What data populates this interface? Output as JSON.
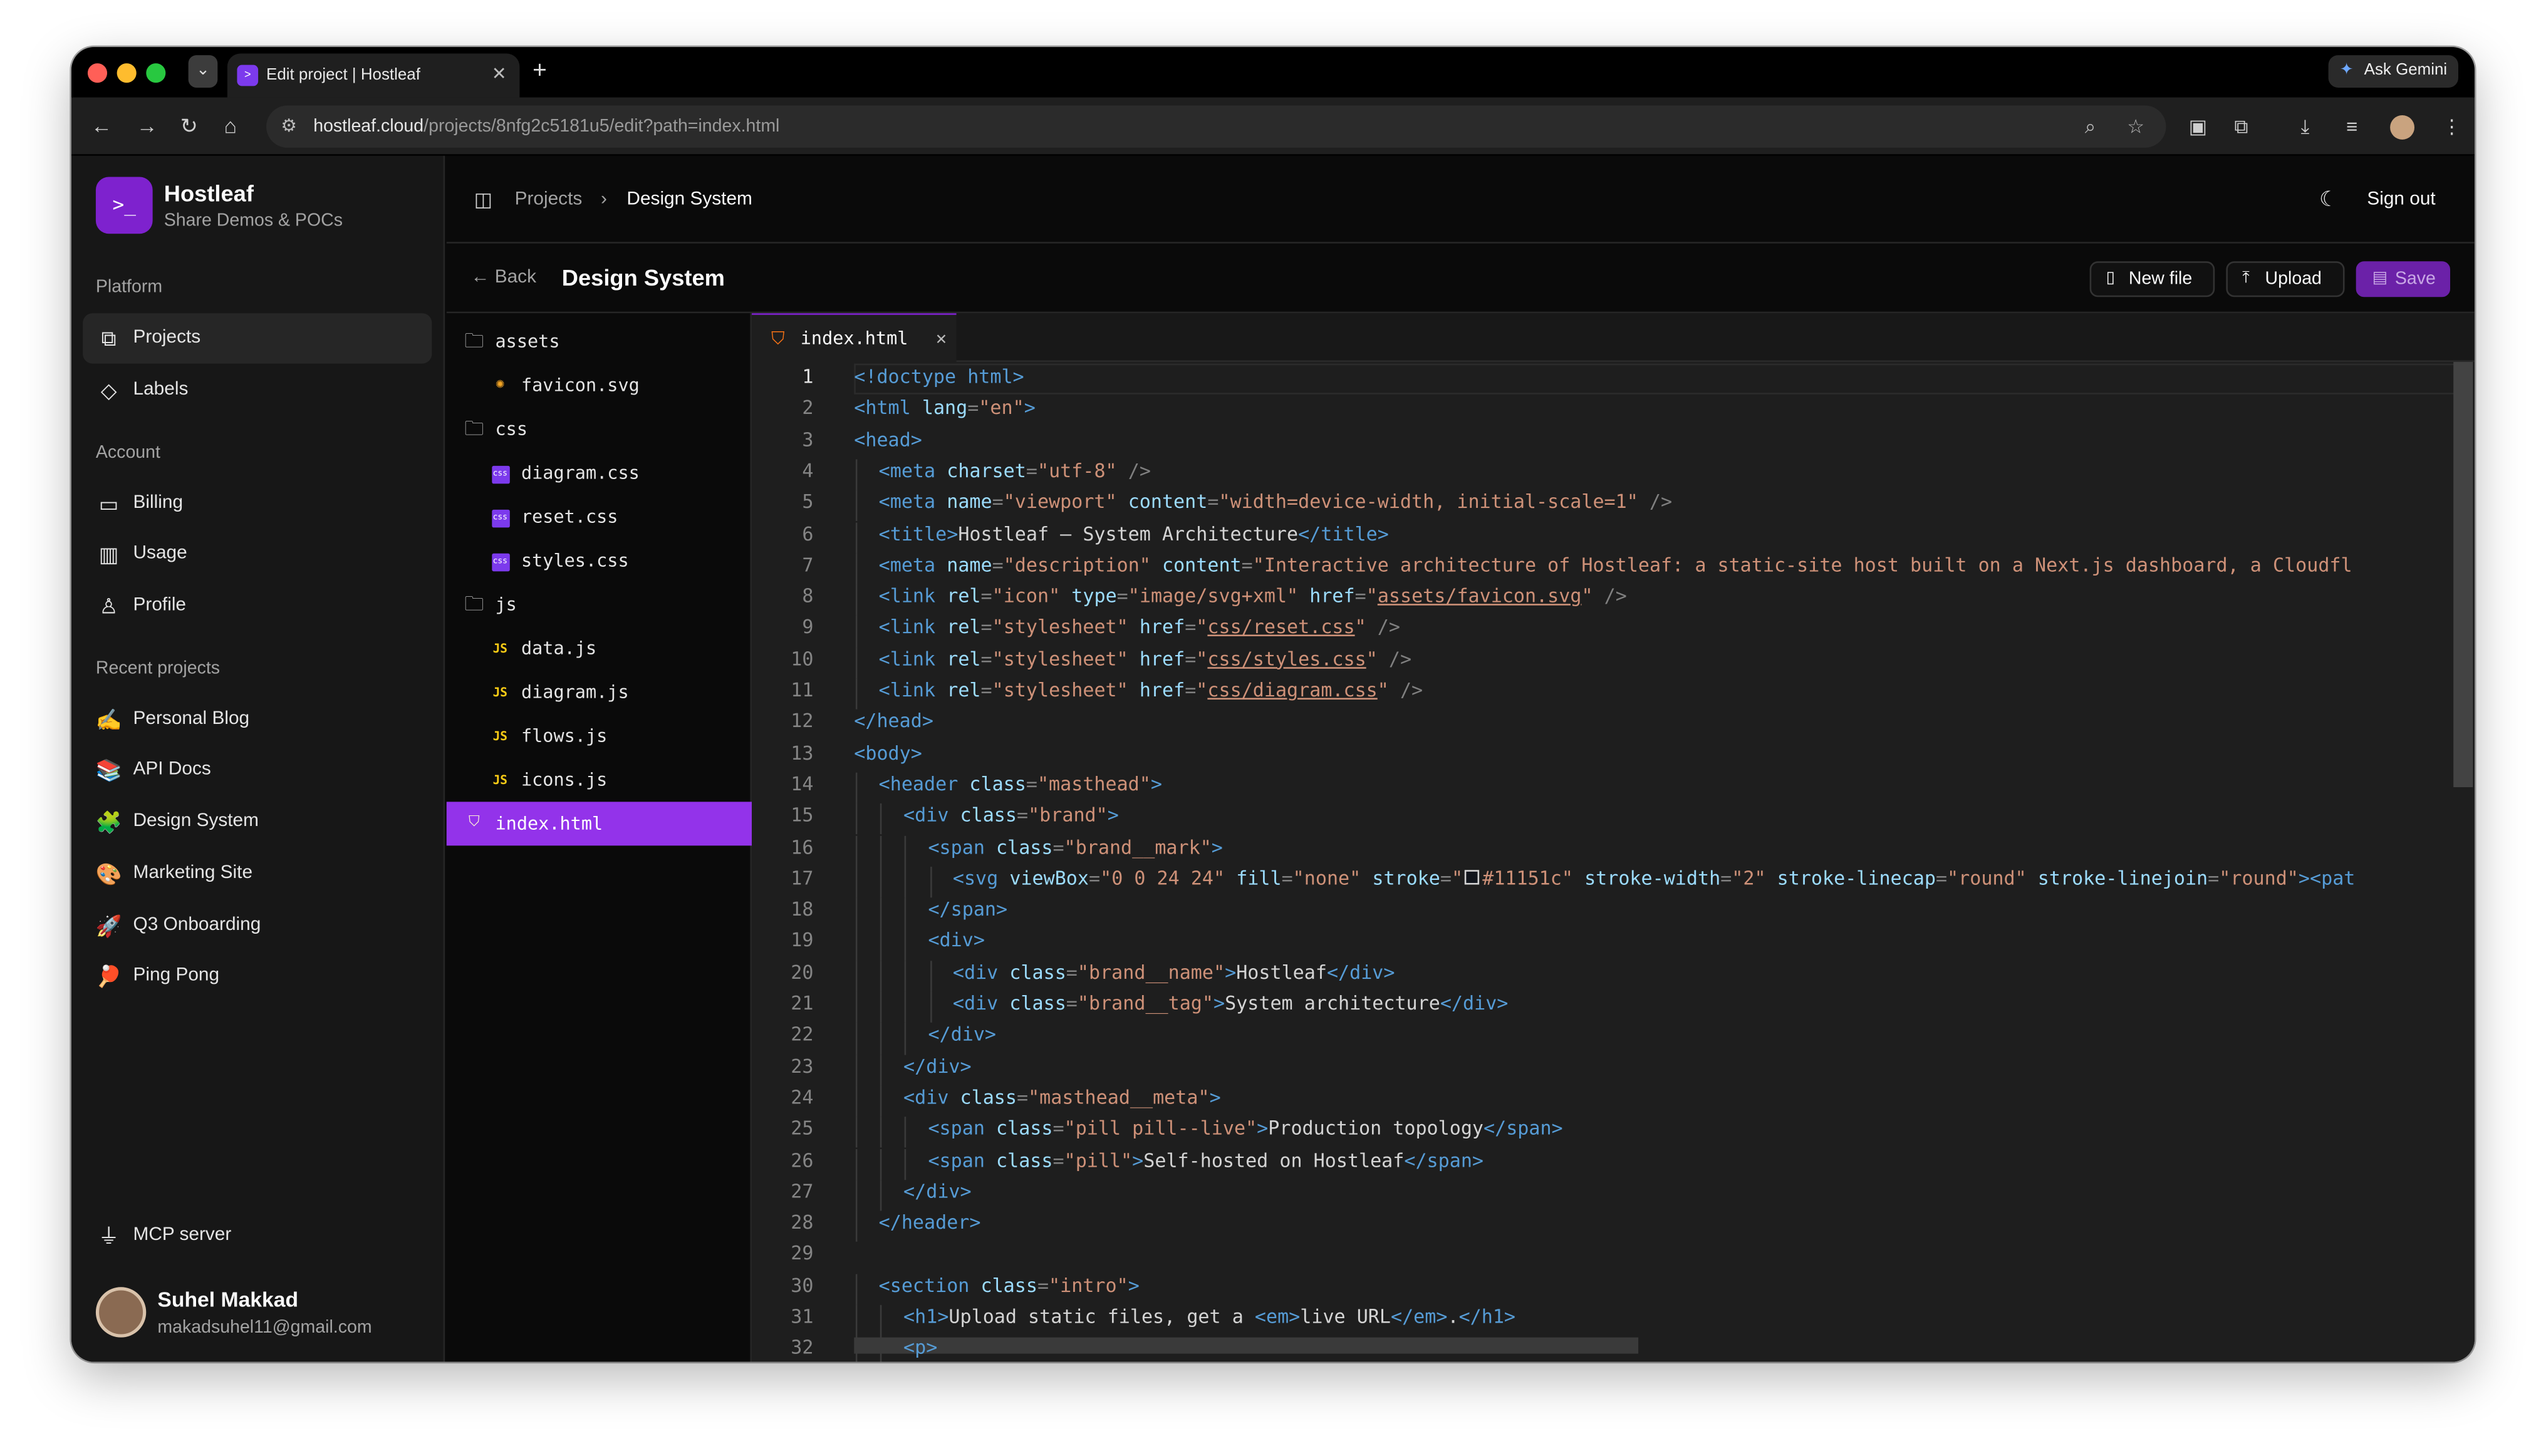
{
  "browser": {
    "tab_title": "Edit project | Hostleaf",
    "ask_gemini": "Ask Gemini",
    "url_host": "hostleaf.cloud",
    "url_path": "/projects/8nfg2c5181u5/edit?path=index.html",
    "traffic_colors": [
      "#ff5f57",
      "#febc2e",
      "#28c840"
    ]
  },
  "sidebar": {
    "brand_name": "Hostleaf",
    "brand_tag": "Share Demos & POCs",
    "logo_glyph": ">_",
    "sections": {
      "platform": "Platform",
      "account": "Account",
      "recent": "Recent projects"
    },
    "platform_items": [
      {
        "label": "Projects",
        "icon": "projects-icon",
        "active": true
      },
      {
        "label": "Labels",
        "icon": "tag-icon"
      }
    ],
    "account_items": [
      {
        "label": "Billing",
        "icon": "credit-card-icon"
      },
      {
        "label": "Usage",
        "icon": "bar-chart-icon"
      },
      {
        "label": "Profile",
        "icon": "user-icon"
      }
    ],
    "recent_projects": [
      {
        "label": "Personal Blog",
        "icon": "✍"
      },
      {
        "label": "API Docs",
        "icon": "📚"
      },
      {
        "label": "Design System",
        "icon": "🧩"
      },
      {
        "label": "Marketing Site",
        "icon": "🎨"
      },
      {
        "label": "Q3 Onboarding",
        "icon": "🚀"
      },
      {
        "label": "Ping Pong",
        "icon": "🏓"
      }
    ],
    "mcp_label": "MCP server",
    "user_name": "Suhel Makkad",
    "user_email": "makadsuhel11@gmail.com"
  },
  "header": {
    "breadcrumb_projects": "Projects",
    "breadcrumb_current": "Design System",
    "sign_out": "Sign out",
    "back": "Back",
    "project_title": "Design System",
    "new_file": "New file",
    "upload": "Upload",
    "save": "Save"
  },
  "files": [
    {
      "name": "assets",
      "type": "folder",
      "depth": 0
    },
    {
      "name": "favicon.svg",
      "type": "svg",
      "depth": 1
    },
    {
      "name": "css",
      "type": "folder",
      "depth": 0
    },
    {
      "name": "diagram.css",
      "type": "css",
      "depth": 1
    },
    {
      "name": "reset.css",
      "type": "css",
      "depth": 1
    },
    {
      "name": "styles.css",
      "type": "css",
      "depth": 1
    },
    {
      "name": "js",
      "type": "folder",
      "depth": 0
    },
    {
      "name": "data.js",
      "type": "js",
      "depth": 1
    },
    {
      "name": "diagram.js",
      "type": "js",
      "depth": 1
    },
    {
      "name": "flows.js",
      "type": "js",
      "depth": 1
    },
    {
      "name": "icons.js",
      "type": "js",
      "depth": 1
    },
    {
      "name": "index.html",
      "type": "html",
      "depth": 0,
      "selected": true
    }
  ],
  "editor": {
    "tab_label": "index.html",
    "current_line": 1,
    "lines": [
      {
        "indent": 0,
        "parts": [
          [
            "tg",
            "<!doctype html>"
          ]
        ]
      },
      {
        "indent": 0,
        "parts": [
          [
            "tg",
            "<html "
          ],
          [
            "at",
            "lang"
          ],
          [
            "pu",
            "="
          ],
          [
            "st",
            "\"en\""
          ],
          [
            "tg",
            ">"
          ]
        ]
      },
      {
        "indent": 0,
        "parts": [
          [
            "tg",
            "<head>"
          ]
        ]
      },
      {
        "indent": 1,
        "parts": [
          [
            "tg",
            "<meta "
          ],
          [
            "at",
            "charset"
          ],
          [
            "pu",
            "="
          ],
          [
            "st",
            "\"utf-8\""
          ],
          [
            "pu",
            " />"
          ]
        ]
      },
      {
        "indent": 1,
        "parts": [
          [
            "tg",
            "<meta "
          ],
          [
            "at",
            "name"
          ],
          [
            "pu",
            "="
          ],
          [
            "st",
            "\"viewport\" "
          ],
          [
            "at",
            "content"
          ],
          [
            "pu",
            "="
          ],
          [
            "st",
            "\"width=device-width, initial-scale=1\""
          ],
          [
            "pu",
            " />"
          ]
        ]
      },
      {
        "indent": 1,
        "parts": [
          [
            "tg",
            "<title>"
          ],
          [
            "tx",
            "Hostleaf — System Architecture"
          ],
          [
            "tg",
            "</title>"
          ]
        ]
      },
      {
        "indent": 1,
        "parts": [
          [
            "tg",
            "<meta "
          ],
          [
            "at",
            "name"
          ],
          [
            "pu",
            "="
          ],
          [
            "st",
            "\"description\" "
          ],
          [
            "at",
            "content"
          ],
          [
            "pu",
            "="
          ],
          [
            "st",
            "\"Interactive architecture of Hostleaf: a static-site host built on a Next.js dashboard, a Cloudfl"
          ]
        ]
      },
      {
        "indent": 1,
        "parts": [
          [
            "tg",
            "<link "
          ],
          [
            "at",
            "rel"
          ],
          [
            "pu",
            "="
          ],
          [
            "st",
            "\"icon\" "
          ],
          [
            "at",
            "type"
          ],
          [
            "pu",
            "="
          ],
          [
            "st",
            "\"image/svg+xml\" "
          ],
          [
            "at",
            "href"
          ],
          [
            "pu",
            "="
          ],
          [
            "st",
            "\""
          ],
          [
            "sl",
            "assets/favicon.svg"
          ],
          [
            "st",
            "\""
          ],
          [
            "pu",
            " />"
          ]
        ]
      },
      {
        "indent": 1,
        "parts": [
          [
            "tg",
            "<link "
          ],
          [
            "at",
            "rel"
          ],
          [
            "pu",
            "="
          ],
          [
            "st",
            "\"stylesheet\" "
          ],
          [
            "at",
            "href"
          ],
          [
            "pu",
            "="
          ],
          [
            "st",
            "\""
          ],
          [
            "sl",
            "css/reset.css"
          ],
          [
            "st",
            "\""
          ],
          [
            "pu",
            " />"
          ]
        ]
      },
      {
        "indent": 1,
        "parts": [
          [
            "tg",
            "<link "
          ],
          [
            "at",
            "rel"
          ],
          [
            "pu",
            "="
          ],
          [
            "st",
            "\"stylesheet\" "
          ],
          [
            "at",
            "href"
          ],
          [
            "pu",
            "="
          ],
          [
            "st",
            "\""
          ],
          [
            "sl",
            "css/styles.css"
          ],
          [
            "st",
            "\""
          ],
          [
            "pu",
            " />"
          ]
        ]
      },
      {
        "indent": 1,
        "parts": [
          [
            "tg",
            "<link "
          ],
          [
            "at",
            "rel"
          ],
          [
            "pu",
            "="
          ],
          [
            "st",
            "\"stylesheet\" "
          ],
          [
            "at",
            "href"
          ],
          [
            "pu",
            "="
          ],
          [
            "st",
            "\""
          ],
          [
            "sl",
            "css/diagram.css"
          ],
          [
            "st",
            "\""
          ],
          [
            "pu",
            " />"
          ]
        ]
      },
      {
        "indent": 0,
        "parts": [
          [
            "tg",
            "</head>"
          ]
        ]
      },
      {
        "indent": 0,
        "parts": [
          [
            "tg",
            "<body>"
          ]
        ]
      },
      {
        "indent": 1,
        "parts": [
          [
            "tg",
            "<header "
          ],
          [
            "at",
            "class"
          ],
          [
            "pu",
            "="
          ],
          [
            "st",
            "\"masthead\""
          ],
          [
            "tg",
            ">"
          ]
        ]
      },
      {
        "indent": 2,
        "parts": [
          [
            "tg",
            "<div "
          ],
          [
            "at",
            "class"
          ],
          [
            "pu",
            "="
          ],
          [
            "st",
            "\"brand\""
          ],
          [
            "tg",
            ">"
          ]
        ]
      },
      {
        "indent": 3,
        "parts": [
          [
            "tg",
            "<span "
          ],
          [
            "at",
            "class"
          ],
          [
            "pu",
            "="
          ],
          [
            "st",
            "\"brand__mark\""
          ],
          [
            "tg",
            ">"
          ]
        ]
      },
      {
        "indent": 4,
        "parts": [
          [
            "tg",
            "<svg "
          ],
          [
            "at",
            "viewBox"
          ],
          [
            "pu",
            "="
          ],
          [
            "st",
            "\"0 0 24 24\" "
          ],
          [
            "at",
            "fill"
          ],
          [
            "pu",
            "="
          ],
          [
            "st",
            "\"none\" "
          ],
          [
            "at",
            "stroke"
          ],
          [
            "pu",
            "="
          ],
          [
            "st",
            "\""
          ],
          [
            "sw",
            ""
          ],
          [
            "st",
            "#11151c\" "
          ],
          [
            "at",
            "stroke-width"
          ],
          [
            "pu",
            "="
          ],
          [
            "st",
            "\"2\" "
          ],
          [
            "at",
            "stroke-linecap"
          ],
          [
            "pu",
            "="
          ],
          [
            "st",
            "\"round\" "
          ],
          [
            "at",
            "stroke-linejoin"
          ],
          [
            "pu",
            "="
          ],
          [
            "st",
            "\"round\""
          ],
          [
            "tg",
            "><pat"
          ]
        ]
      },
      {
        "indent": 3,
        "parts": [
          [
            "tg",
            "</span>"
          ]
        ]
      },
      {
        "indent": 3,
        "parts": [
          [
            "tg",
            "<div>"
          ]
        ]
      },
      {
        "indent": 4,
        "parts": [
          [
            "tg",
            "<div "
          ],
          [
            "at",
            "class"
          ],
          [
            "pu",
            "="
          ],
          [
            "st",
            "\"brand__name\""
          ],
          [
            "tg",
            ">"
          ],
          [
            "tx",
            "Hostleaf"
          ],
          [
            "tg",
            "</div>"
          ]
        ]
      },
      {
        "indent": 4,
        "parts": [
          [
            "tg",
            "<div "
          ],
          [
            "at",
            "class"
          ],
          [
            "pu",
            "="
          ],
          [
            "st",
            "\"brand__tag\""
          ],
          [
            "tg",
            ">"
          ],
          [
            "tx",
            "System architecture"
          ],
          [
            "tg",
            "</div>"
          ]
        ]
      },
      {
        "indent": 3,
        "parts": [
          [
            "tg",
            "</div>"
          ]
        ]
      },
      {
        "indent": 2,
        "parts": [
          [
            "tg",
            "</div>"
          ]
        ]
      },
      {
        "indent": 2,
        "parts": [
          [
            "tg",
            "<div "
          ],
          [
            "at",
            "class"
          ],
          [
            "pu",
            "="
          ],
          [
            "st",
            "\"masthead__meta\""
          ],
          [
            "tg",
            ">"
          ]
        ]
      },
      {
        "indent": 3,
        "parts": [
          [
            "tg",
            "<span "
          ],
          [
            "at",
            "class"
          ],
          [
            "pu",
            "="
          ],
          [
            "st",
            "\"pill pill--live\""
          ],
          [
            "tg",
            ">"
          ],
          [
            "tx",
            "Production topology"
          ],
          [
            "tg",
            "</span>"
          ]
        ]
      },
      {
        "indent": 3,
        "parts": [
          [
            "tg",
            "<span "
          ],
          [
            "at",
            "class"
          ],
          [
            "pu",
            "="
          ],
          [
            "st",
            "\"pill\""
          ],
          [
            "tg",
            ">"
          ],
          [
            "tx",
            "Self-hosted on Hostleaf"
          ],
          [
            "tg",
            "</span>"
          ]
        ]
      },
      {
        "indent": 2,
        "parts": [
          [
            "tg",
            "</div>"
          ]
        ]
      },
      {
        "indent": 1,
        "parts": [
          [
            "tg",
            "</header>"
          ]
        ]
      },
      {
        "indent": 0,
        "parts": []
      },
      {
        "indent": 1,
        "parts": [
          [
            "tg",
            "<section "
          ],
          [
            "at",
            "class"
          ],
          [
            "pu",
            "="
          ],
          [
            "st",
            "\"intro\""
          ],
          [
            "tg",
            ">"
          ]
        ]
      },
      {
        "indent": 2,
        "parts": [
          [
            "tg",
            "<h1>"
          ],
          [
            "tx",
            "Upload static files, get a "
          ],
          [
            "tg",
            "<em>"
          ],
          [
            "tx",
            "live URL"
          ],
          [
            "tg",
            "</em>"
          ],
          [
            "tx",
            "."
          ],
          [
            "tg",
            "</h1>"
          ]
        ]
      },
      {
        "indent": 2,
        "parts": [
          [
            "tg",
            "<p>"
          ]
        ]
      }
    ]
  }
}
